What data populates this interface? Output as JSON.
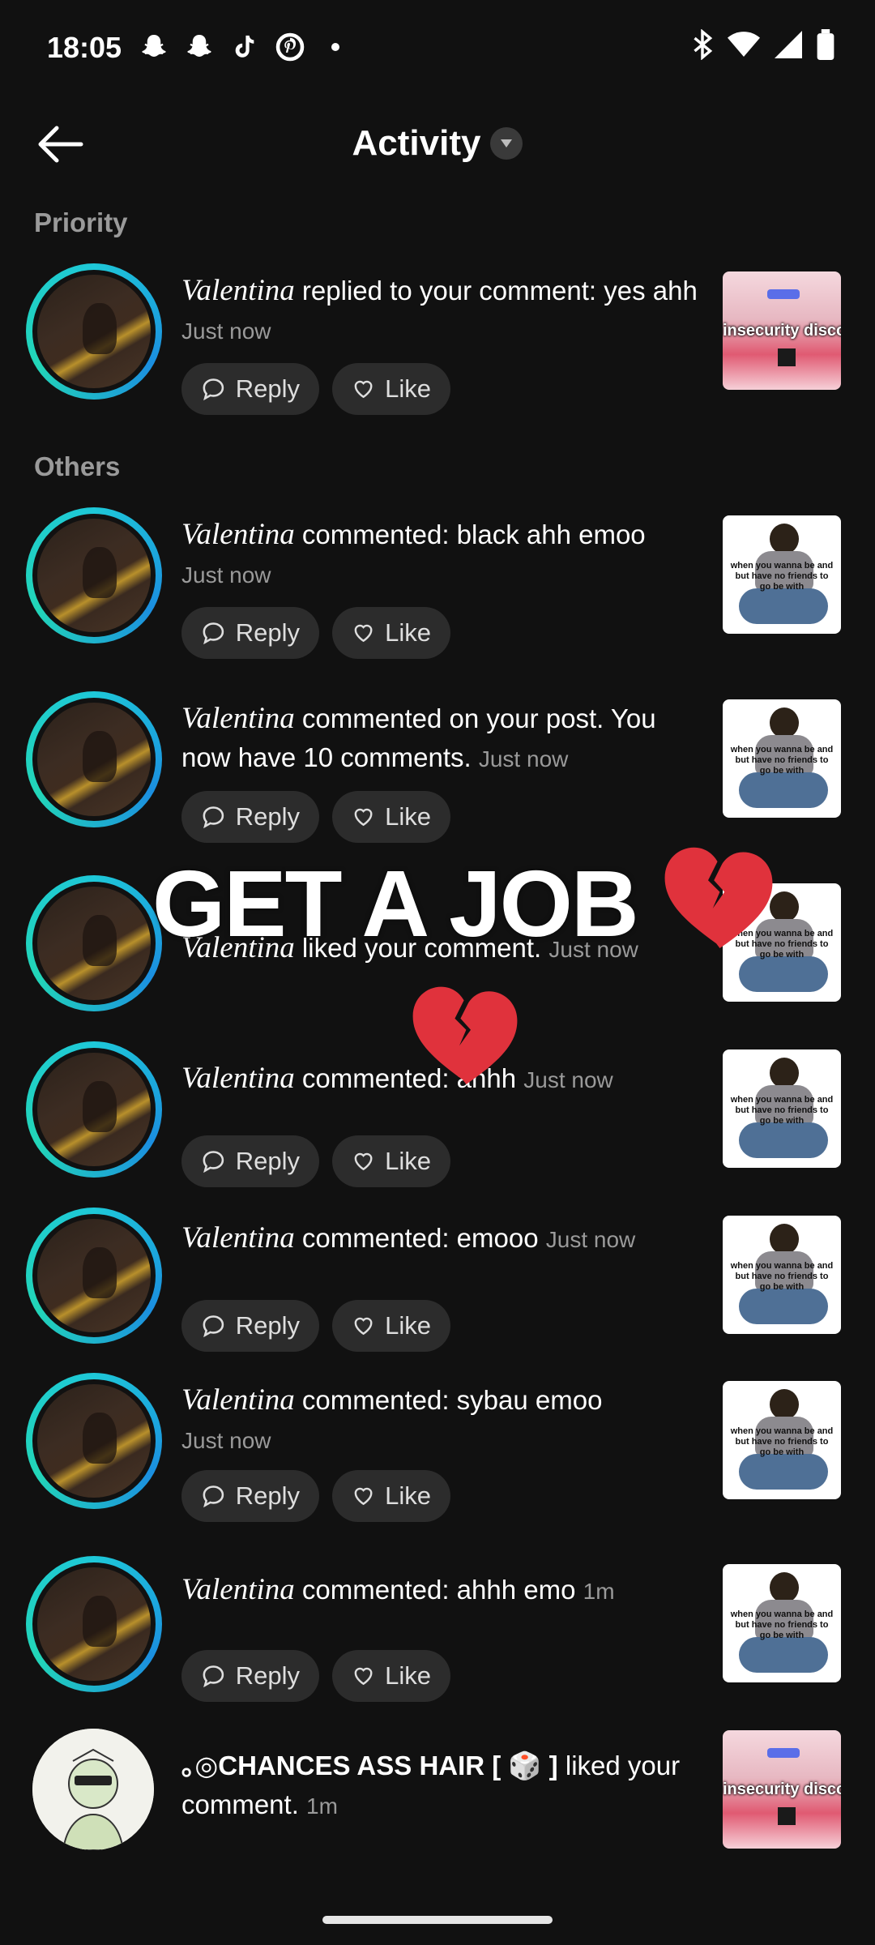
{
  "status_bar": {
    "time": "18:05",
    "app_icons": [
      "snapchat-icon",
      "snapchat-icon",
      "tiktok-icon",
      "pinterest-icon",
      "dot-icon"
    ],
    "system_icons": [
      "bluetooth-icon",
      "wifi-icon",
      "signal-icon",
      "battery-icon"
    ]
  },
  "header": {
    "title": "Activity"
  },
  "sections": {
    "priority": "Priority",
    "others": "Others"
  },
  "actions": {
    "reply": "Reply",
    "like": "Like"
  },
  "overlay": {
    "caption": "GET A JOB",
    "emoji": "💔"
  },
  "priority_items": [
    {
      "name": "Valentina",
      "message": " replied to your comment: yes ahh ",
      "time": "Just now"
    }
  ],
  "other_items": [
    {
      "name": "Valentina",
      "message": " commented: black ahh emoo ",
      "time": "Just now"
    },
    {
      "name": "Valentina",
      "message": " commented on your post. You now have 10 comments. ",
      "time": "Just now"
    },
    {
      "name": "Valentina",
      "message": " liked your comment. ",
      "time": "Just now"
    },
    {
      "name": "Valentina",
      "message": " commented: ahhh ",
      "time": "Just now"
    },
    {
      "name": "Valentina",
      "message": " commented: emooo ",
      "time": "Just now"
    },
    {
      "name": "Valentina",
      "message": " commented: sybau emoo ",
      "time": "Just now"
    },
    {
      "name": "Valentina",
      "message": " commented: ahhh emo ",
      "time": "1m"
    },
    {
      "name": "｡◎CHANCES ASS HAIR [ 🎲 ]",
      "message": " liked your comment. ",
      "time": "1m"
    }
  ],
  "thumbnails": {
    "pink_caption": "insecurity discov",
    "person_caption": "when you wanna be and but have no friends to go be with"
  },
  "colors": {
    "background": "#111111",
    "ring": "#1ec8d8",
    "button_bg": "#2c2c2c",
    "muted": "#9a9a9a"
  }
}
